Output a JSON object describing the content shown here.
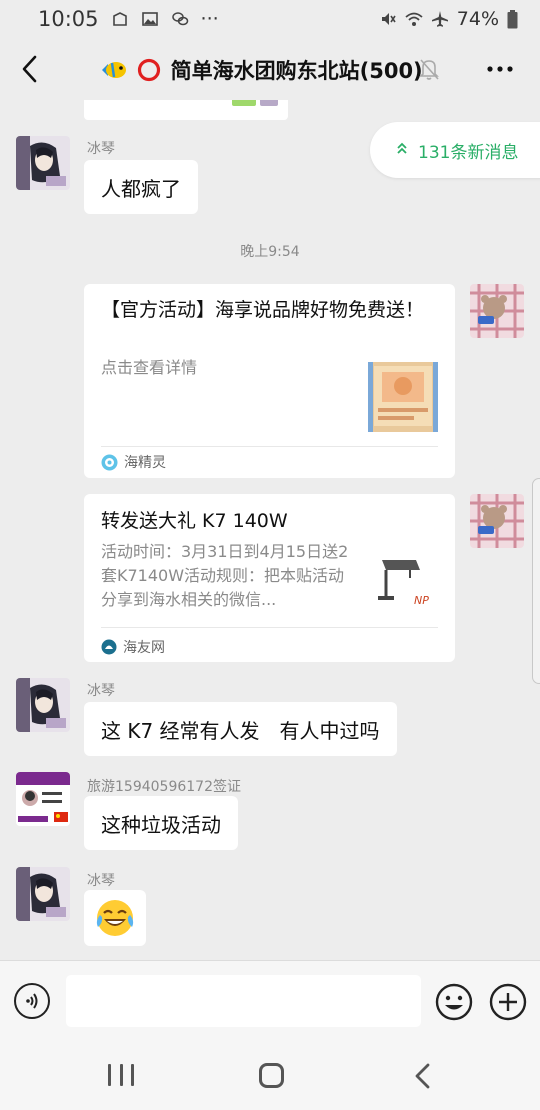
{
  "status_bar": {
    "time": "10:05",
    "dots": "···",
    "battery": "74%"
  },
  "header": {
    "title": "简单海水团购东北站(500)"
  },
  "new_messages": "131条新消息",
  "messages": [
    {
      "sender": "冰琴",
      "text": "人都疯了"
    },
    {
      "timestamp": "晚上9:54"
    },
    {
      "card_title": "【官方活动】海享说品牌好物免费送！",
      "card_desc": "点击查看详情",
      "source": "海精灵"
    },
    {
      "card_title": "转发送大礼 K7 140W",
      "card_desc": "活动时间：3月31日到4月15日送2套K7140W活动规则：把本贴活动分享到海水相关的微信...",
      "source": "海友网"
    },
    {
      "sender": "冰琴",
      "text": "这 K7 经常有人发　有人中过吗"
    },
    {
      "sender": "旅游15940596172签证",
      "text": "这种垃圾活动"
    },
    {
      "sender": "冰琴",
      "text": "😂"
    }
  ],
  "input": {
    "placeholder": ""
  },
  "colors": {
    "accent_green": "#2aae67",
    "background": "#ededed"
  },
  "icons": [
    "back-icon",
    "mute-icon",
    "more-icon",
    "voice-icon",
    "emoji-icon",
    "plus-icon",
    "chevron-up-icon"
  ]
}
